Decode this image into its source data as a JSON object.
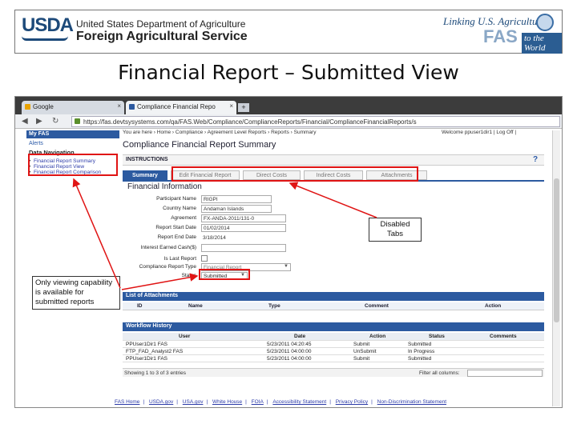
{
  "banner": {
    "usda_logo": "USDA",
    "line1": "United States Department of Agriculture",
    "line2": "Foreign Agricultural Service",
    "fas_tagline": "Linking U.S. Agriculture",
    "fas_letters": "FAS",
    "fas_world": "to the World"
  },
  "slide_title": "Financial Report – Submitted View",
  "browser": {
    "tabs": [
      {
        "label": "Google",
        "close": "×"
      },
      {
        "label": "Compliance Financial Repo",
        "close": "×"
      }
    ],
    "new_tab": "+",
    "nav_icons": [
      "◀",
      "▶",
      "↻"
    ],
    "url": "https://fas.devtsysystems.com/qa/FAS.Web/Compliance/ComplianceReports/Financial/ComplianceFinancialReports/s"
  },
  "leftnav": {
    "header": "My FAS",
    "alerts": "Alerts",
    "section": "Data Navigation",
    "links": [
      "Financial Report Summary",
      "Financial Report View",
      "Financial Report Comparison"
    ]
  },
  "main": {
    "breadcrumb": "You are here › Home › Compliance › Agreement Level Reports › Reports › Summary",
    "welcome": "Welcome ppuser1dir1 | Log Off |",
    "page_heading": "Compliance Financial Report Summary",
    "instructions": "INSTRUCTIONS",
    "help": "?",
    "tabs": [
      {
        "label": "Summary",
        "active": true
      },
      {
        "label": "Edit Financial Report",
        "active": false
      },
      {
        "label": "Direct Costs",
        "active": false
      },
      {
        "label": "Indirect Costs",
        "active": false
      },
      {
        "label": "Attachments",
        "active": false
      }
    ],
    "financial_heading": "Financial Information",
    "fields": [
      {
        "label": "Participant Name",
        "value": "RIGPI"
      },
      {
        "label": "Country Name",
        "value": "Andaman Islands"
      },
      {
        "label": "Agreement",
        "value": "FX-ANDA-2011/131-0"
      },
      {
        "label": "Report Start Date",
        "value": "01/02/2014"
      },
      {
        "label": "Report End Date",
        "value": "3/18/2014"
      },
      {
        "label": "Interest Earned Cash($)",
        "value": ""
      },
      {
        "label": "Is Last Report",
        "value": ""
      },
      {
        "label": "Compliance Report Type",
        "value": "Financial Report"
      },
      {
        "label": "Status",
        "value": "Submitted"
      }
    ],
    "select_caret": "▼",
    "attachments_heading": "List of Attachments",
    "attachments_cols": [
      "ID",
      "Name",
      "Type",
      "Comment",
      "Action"
    ],
    "workflow_heading": "Workflow History",
    "workflow_cols": [
      "User",
      "Date",
      "Action",
      "Status",
      "Comments"
    ],
    "workflow_rows": [
      {
        "user": "PPUser1Dir1 FAS",
        "date": "5/23/2011 04:20:45",
        "action": "Submit",
        "status": "Submitted",
        "comments": ""
      },
      {
        "user": "FTP_FAD_Analyst2 FAS",
        "date": "5/23/2011 04:00:00",
        "action": "UnSubmit",
        "status": "In Progress",
        "comments": ""
      },
      {
        "user": "PPUser1Dir1 FAS",
        "date": "5/23/2011 04:00:00",
        "action": "Submit",
        "status": "Submitted",
        "comments": ""
      }
    ],
    "workflow_count": "Showing 1 to 3 of 3 entries",
    "filter_label": "Filter all columns:"
  },
  "footer_links": [
    "FAS Home",
    "USDA.gov",
    "USA.gov",
    "White House",
    "FOIA",
    "Accessibility Statement",
    "Privacy Policy",
    "Non-Discrimination Statement"
  ],
  "callouts": {
    "disabled_tabs": "Disabled Tabs",
    "viewing_note": "Only viewing capability is available for submitted reports"
  },
  "colors": {
    "accent": "#2c5aa0",
    "callout_red": "#e01414"
  }
}
